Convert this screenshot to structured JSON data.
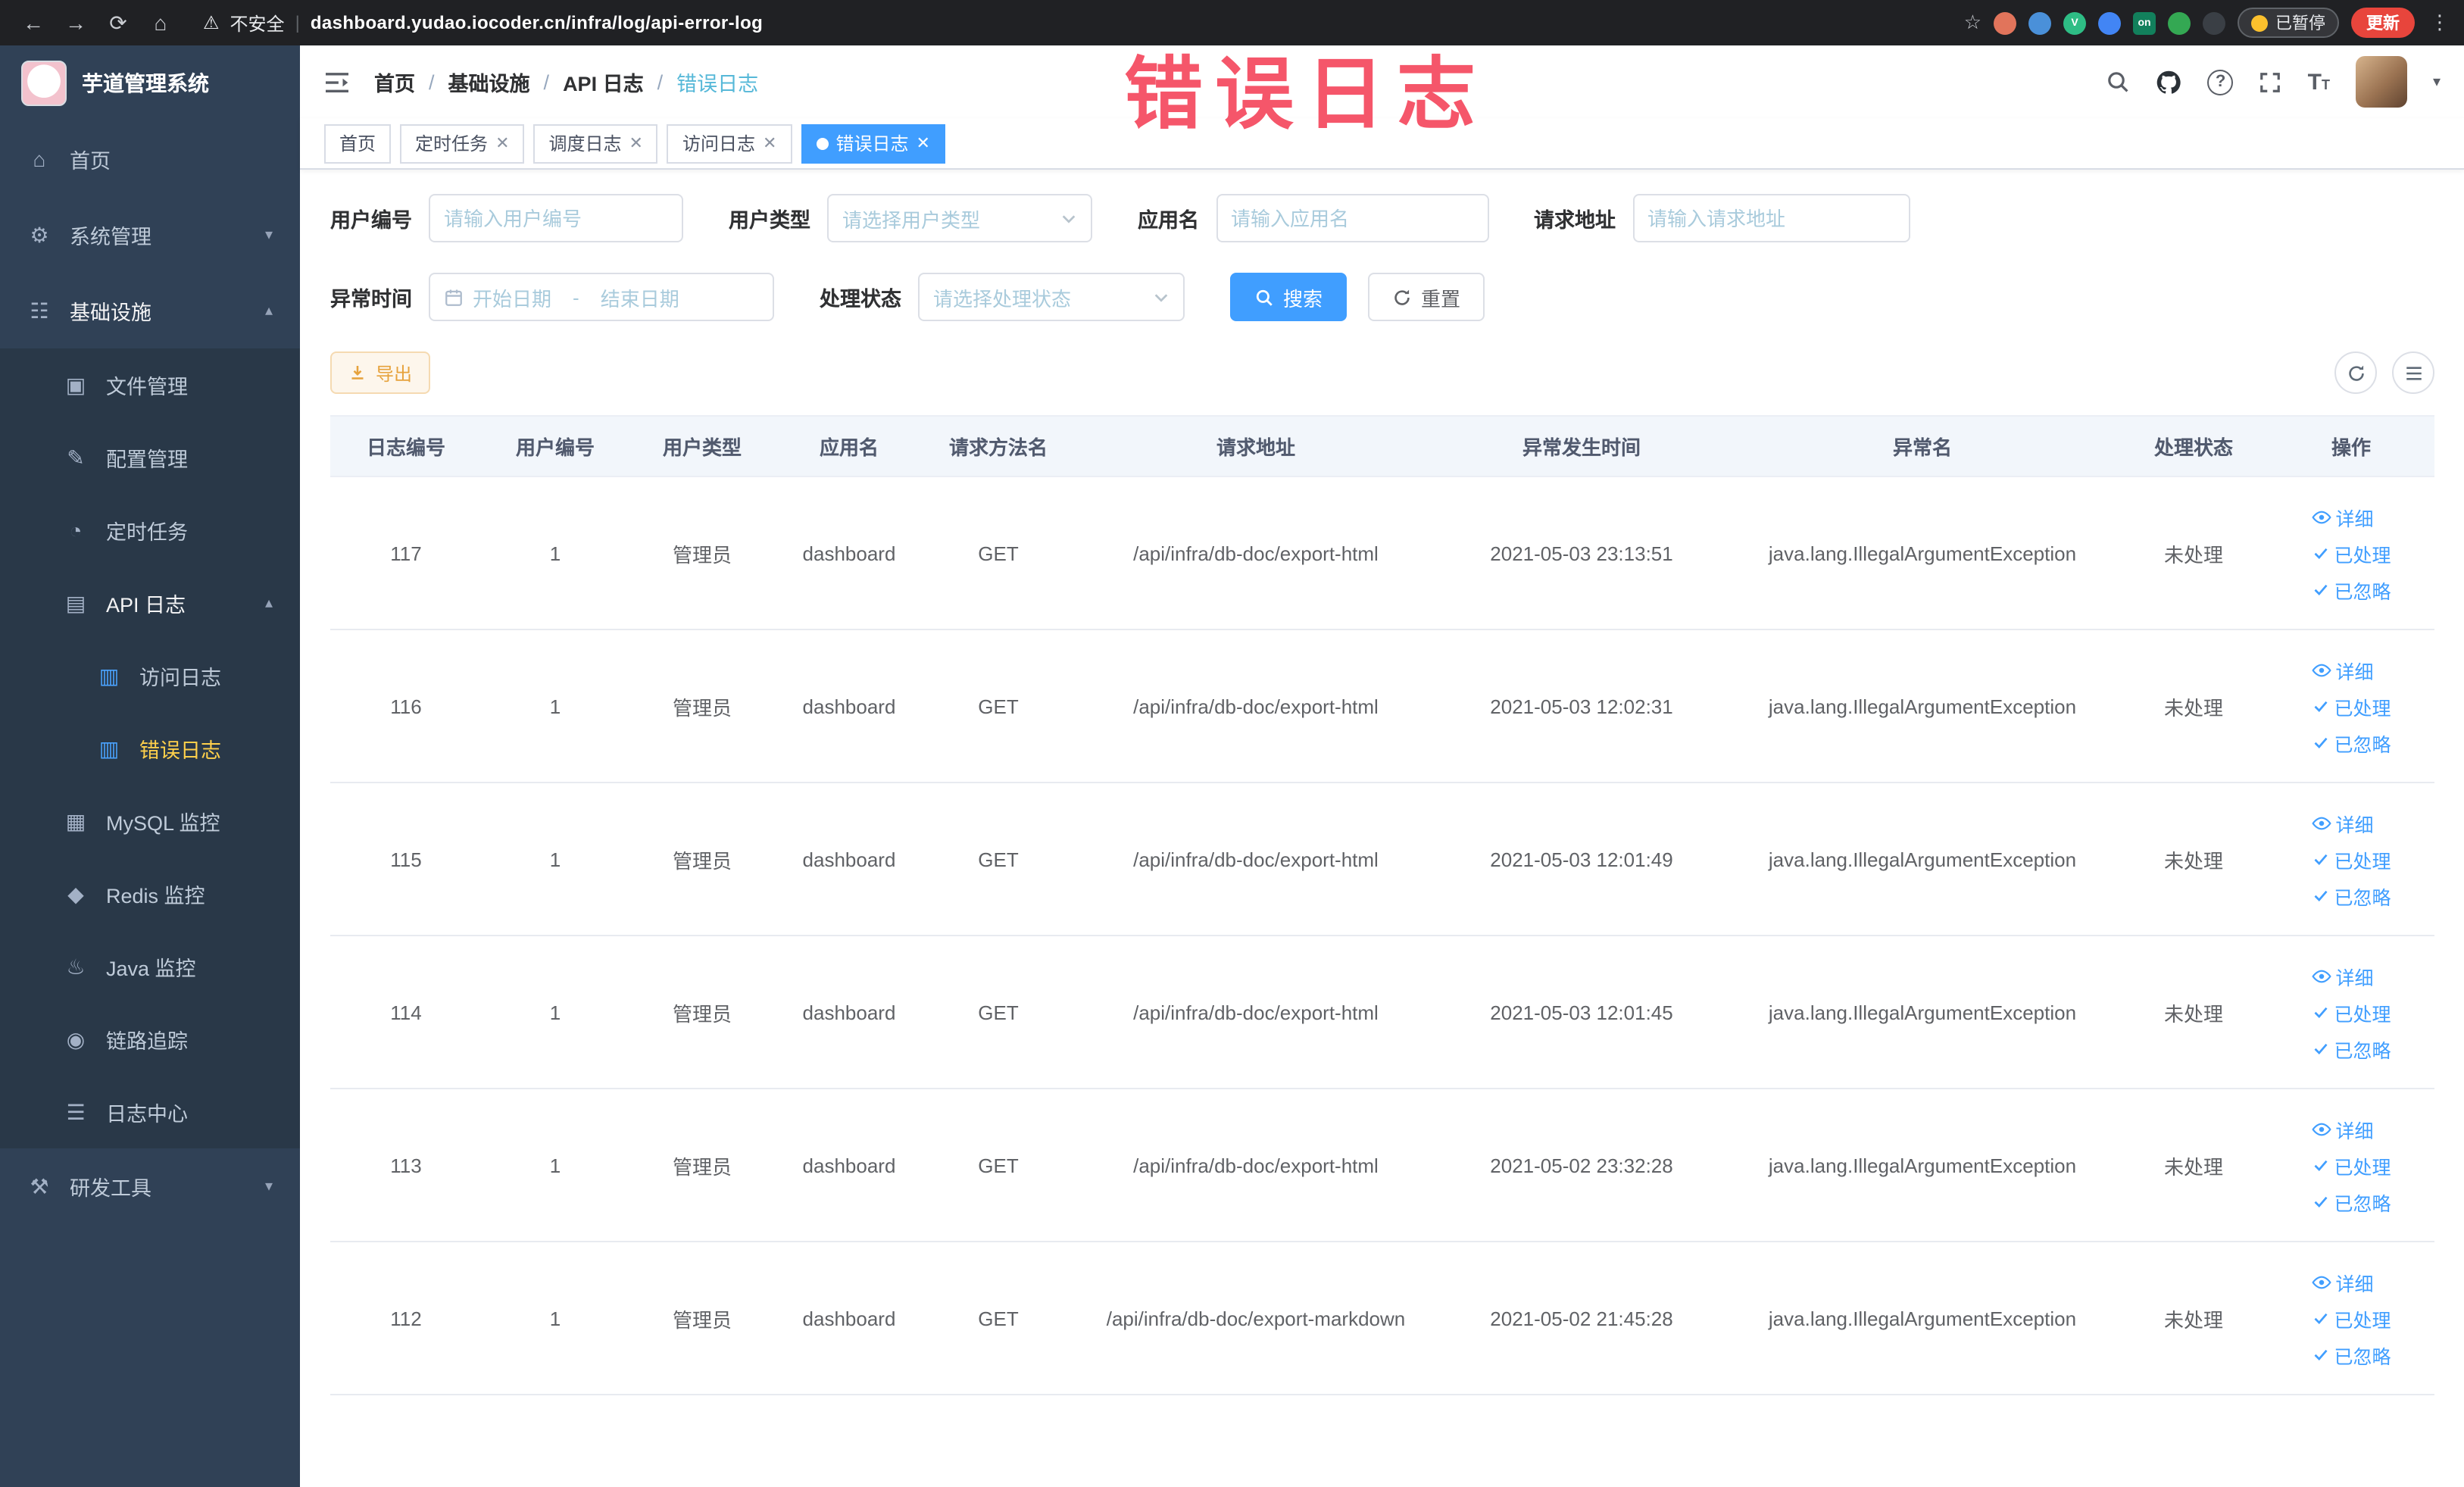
{
  "colors": {
    "accent": "#409eff",
    "sidebar_bg": "#304156",
    "active_menu_text": "#ffd04b",
    "warning": "#e6a23c",
    "annotation": "#f5485e",
    "tag_active_bg": "#409eff"
  },
  "browser": {
    "security_label": "不安全",
    "url": "dashboard.yudao.iocoder.cn/infra/log/api-error-log",
    "extension_badge": "on",
    "paused_label": "已暂停",
    "update_label": "更新"
  },
  "annotation": {
    "text": "错误日志"
  },
  "sidebar": {
    "logo_title": "芋道管理系统",
    "items": [
      "首页",
      "系统管理",
      "基础设施",
      "文件管理",
      "配置管理",
      "定时任务",
      "API 日志",
      "访问日志",
      "错误日志",
      "MySQL 监控",
      "Redis 监控",
      "Java 监控",
      "链路追踪",
      "日志中心",
      "研发工具"
    ]
  },
  "breadcrumb": [
    "首页",
    "基础设施",
    "API 日志",
    "错误日志"
  ],
  "tabs": [
    "首页",
    "定时任务",
    "调度日志",
    "访问日志",
    "错误日志"
  ],
  "filters": {
    "user_id_label": "用户编号",
    "user_id_placeholder": "请输入用户编号",
    "user_type_label": "用户类型",
    "user_type_placeholder": "请选择用户类型",
    "app_name_label": "应用名",
    "app_name_placeholder": "请输入应用名",
    "request_url_label": "请求地址",
    "request_url_placeholder": "请输入请求地址",
    "time_label": "异常时间",
    "time_start_placeholder": "开始日期",
    "time_separator": "-",
    "time_end_placeholder": "结束日期",
    "status_label": "处理状态",
    "status_placeholder": "请选择处理状态",
    "search_label": "搜索",
    "reset_label": "重置"
  },
  "toolbar": {
    "export_label": "导出"
  },
  "table": {
    "columns": [
      "日志编号",
      "用户编号",
      "用户类型",
      "应用名",
      "请求方法名",
      "请求地址",
      "异常发生时间",
      "异常名",
      "处理状态",
      "操作"
    ],
    "action_detail": "详细",
    "action_processed": "已处理",
    "action_ignored": "已忽略",
    "rows": [
      {
        "id": "117",
        "user_id": "1",
        "user_type": "管理员",
        "app": "dashboard",
        "method": "GET",
        "url": "/api/infra/db-doc/export-html",
        "time": "2021-05-03 23:13:51",
        "exception": "java.lang.IllegalArgumentException",
        "status": "未处理"
      },
      {
        "id": "116",
        "user_id": "1",
        "user_type": "管理员",
        "app": "dashboard",
        "method": "GET",
        "url": "/api/infra/db-doc/export-html",
        "time": "2021-05-03 12:02:31",
        "exception": "java.lang.IllegalArgumentException",
        "status": "未处理"
      },
      {
        "id": "115",
        "user_id": "1",
        "user_type": "管理员",
        "app": "dashboard",
        "method": "GET",
        "url": "/api/infra/db-doc/export-html",
        "time": "2021-05-03 12:01:49",
        "exception": "java.lang.IllegalArgumentException",
        "status": "未处理"
      },
      {
        "id": "114",
        "user_id": "1",
        "user_type": "管理员",
        "app": "dashboard",
        "method": "GET",
        "url": "/api/infra/db-doc/export-html",
        "time": "2021-05-03 12:01:45",
        "exception": "java.lang.IllegalArgumentException",
        "status": "未处理"
      },
      {
        "id": "113",
        "user_id": "1",
        "user_type": "管理员",
        "app": "dashboard",
        "method": "GET",
        "url": "/api/infra/db-doc/export-html",
        "time": "2021-05-02 23:32:28",
        "exception": "java.lang.IllegalArgumentException",
        "status": "未处理"
      },
      {
        "id": "112",
        "user_id": "1",
        "user_type": "管理员",
        "app": "dashboard",
        "method": "GET",
        "url": "/api/infra/db-doc/export-markdown",
        "time": "2021-05-02 21:45:28",
        "exception": "java.lang.IllegalArgumentException",
        "status": "未处理"
      }
    ]
  }
}
